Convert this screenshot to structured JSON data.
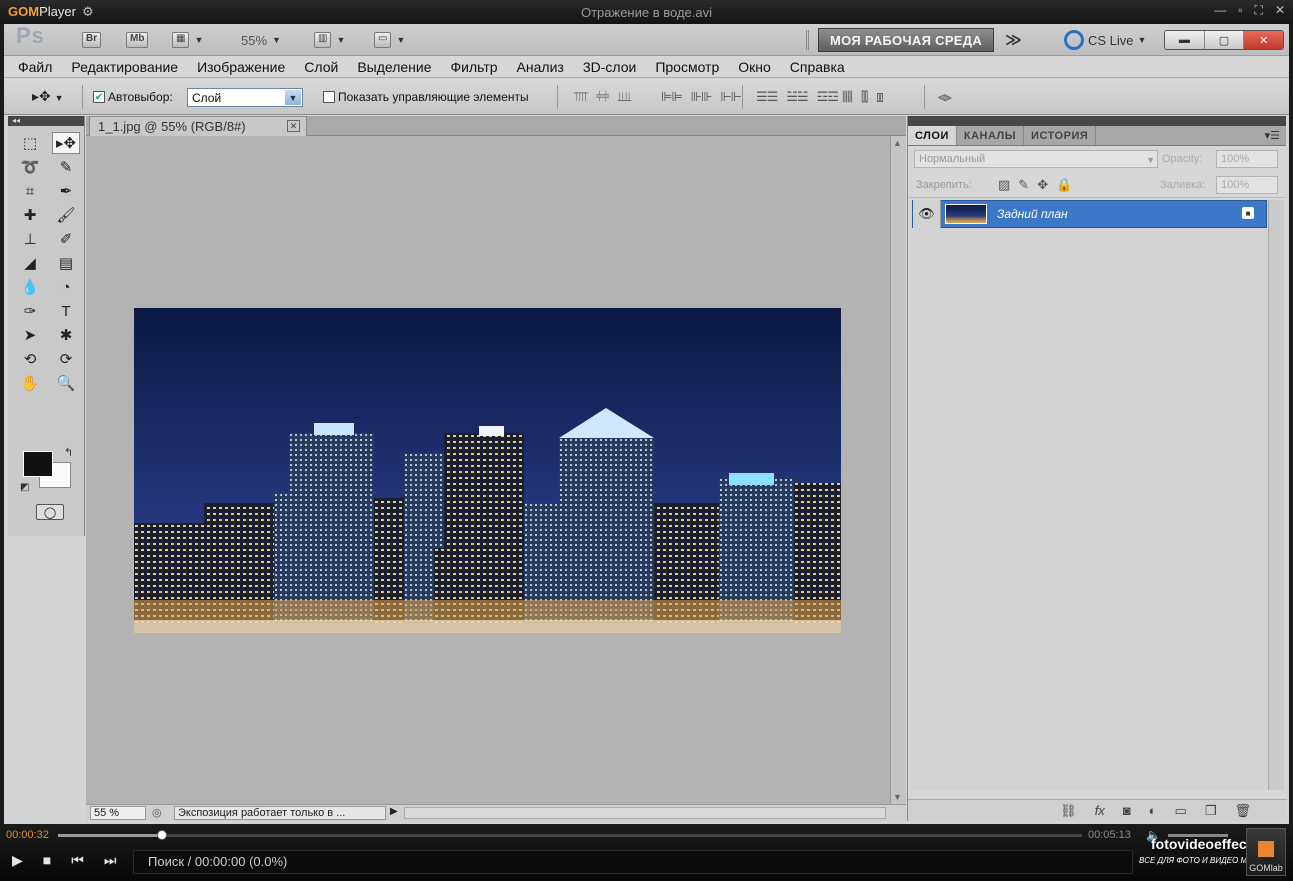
{
  "gom": {
    "logo_a": "GOM",
    "logo_b": "Player",
    "file_title": "Отражение в воде.avi",
    "time_elapsed": "00:00:32",
    "time_total": "00:05:13",
    "seek_progress": 0.102,
    "status_text": "Поиск / 00:00:00 (0.0%)",
    "brand": "GOMlab"
  },
  "watermark": {
    "site": "fotovideoeffect.com",
    "tagline": "ВСЕ ДЛЯ ФОТО И ВИДЕО МОНТАЖА!"
  },
  "appbar": {
    "logo": "Ps",
    "bridge": "Br",
    "minibridge": "Mb",
    "zoom": "55%",
    "workspace": "МОЯ РАБОЧАЯ СРЕДА",
    "cs_live": "CS Live"
  },
  "menu": [
    "Файл",
    "Редактирование",
    "Изображение",
    "Слой",
    "Выделение",
    "Фильтр",
    "Анализ",
    "3D-слои",
    "Просмотр",
    "Окно",
    "Справка"
  ],
  "options": {
    "autoselect_label": "Автовыбор:",
    "autoselect_checked": true,
    "autoselect_value": "Слой",
    "show_controls_label": "Показать управляющие элементы",
    "show_controls_checked": false
  },
  "document": {
    "tab_title": "1_1.jpg @ 55% (RGB/8#)",
    "zoom": "55 %",
    "status_text": "Экспозиция работает только в ..."
  },
  "layers_panel": {
    "tabs": [
      "СЛОИ",
      "КАНАЛЫ",
      "ИСТОРИЯ"
    ],
    "blend_mode": "Нормальный",
    "opacity_label": "Opacity:",
    "opacity": "100%",
    "lock_label": "Закрепить:",
    "fill_label": "Заливка:",
    "fill": "100%",
    "layers": [
      {
        "name": "Задний план",
        "visible": true,
        "locked": true,
        "selected": true
      }
    ]
  },
  "colors": {
    "selection_blue": "#3b78c8",
    "workspace_btn": "#6e6e6e",
    "gom_accent": "#e08a2c"
  }
}
